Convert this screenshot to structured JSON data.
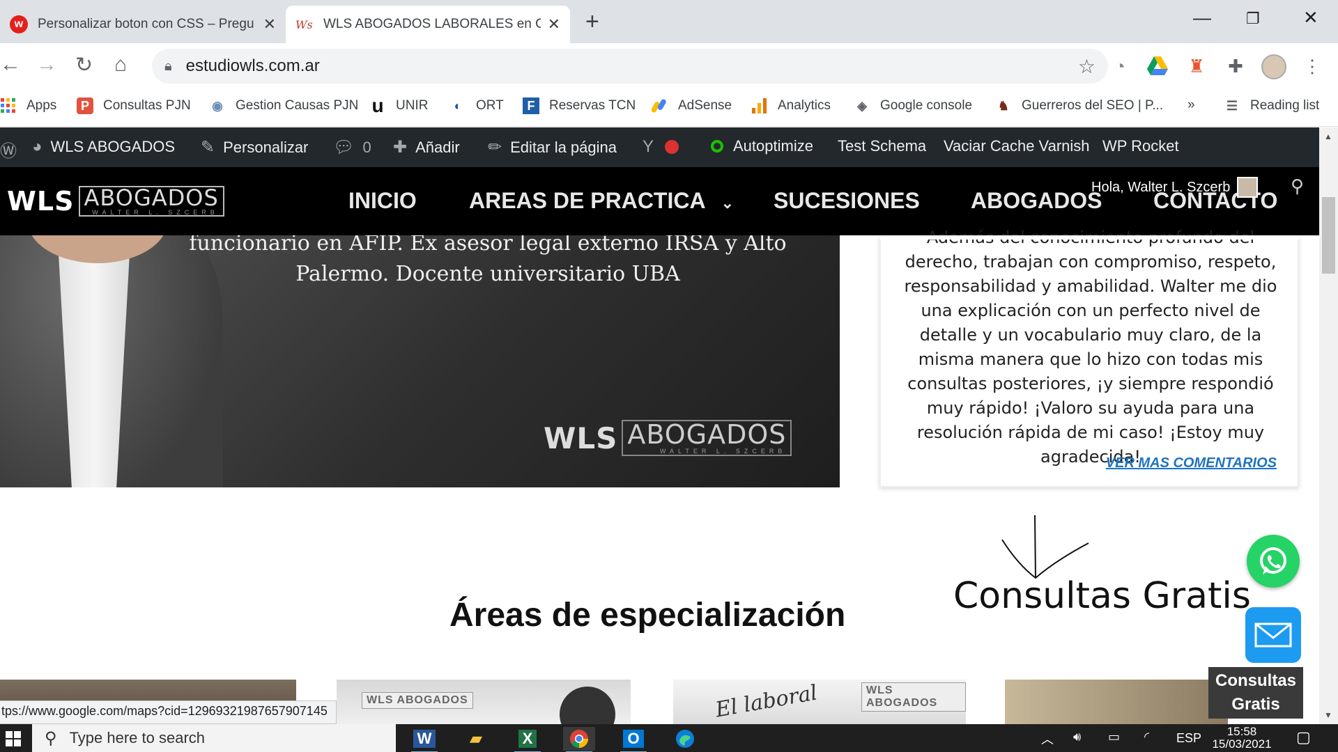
{
  "browser": {
    "tabs": [
      {
        "title": "Personalizar boton con CSS – Pregu",
        "active": false
      },
      {
        "title": "WLS ABOGADOS LABORALES en Ca",
        "active": true
      }
    ],
    "new_tab_symbol": "+",
    "url": "estudiowls.com.ar",
    "bookmarks": [
      {
        "label": "Apps",
        "icon": "apps-grid-icon"
      },
      {
        "label": "Consultas PJN",
        "icon": "pjn-icon"
      },
      {
        "label": "Gestion Causas PJN",
        "icon": "argentina-seal-icon"
      },
      {
        "label": "UNIR",
        "icon": "unir-icon"
      },
      {
        "label": "ORT",
        "icon": "ort-icon"
      },
      {
        "label": "Reservas TCN",
        "icon": "tcn-icon"
      },
      {
        "label": "AdSense",
        "icon": "adsense-icon"
      },
      {
        "label": "Analytics",
        "icon": "analytics-icon"
      },
      {
        "label": "Google console",
        "icon": "search-console-icon"
      },
      {
        "label": "Guerreros del SEO | P...",
        "icon": "seo-warrior-icon"
      }
    ],
    "bookmarks_overflow": "»",
    "reading_list": "Reading list"
  },
  "adminbar": {
    "site": "WLS ABOGADOS",
    "customize": "Personalizar",
    "comments_count": "0",
    "add": "Añadir",
    "edit_page": "Editar la página",
    "autoptimize": "Autoptimize",
    "test_schema": "Test Schema",
    "varnish": "Vaciar Cache Varnish",
    "wp_rocket": "WP Rocket"
  },
  "site": {
    "logo_wls": "WLS",
    "logo_abogados": "ABOGADOS",
    "logo_sub": "WALTER L. SZCERB",
    "menu": [
      "INICIO",
      "AREAS DE PRACTICA",
      "SUCESIONES",
      "ABOGADOS",
      "CONTACTO"
    ],
    "greeting": "Hola, Walter L. Szcerb"
  },
  "hero": {
    "line1": "funcionario en AFIP.  Ex asesor legal externo IRSA y Alto",
    "line2": "Palermo. Docente universitario UBA"
  },
  "testimonial": {
    "text": "Además del conocimiento profundo del derecho, trabajan con compromiso, respeto, responsabilidad y amabilidad. Walter me dio una explicación con un perfecto nivel de detalle y un vocabulario muy claro, de la misma manera que lo hizo con todas mis consultas posteriores, ¡y siempre respondió muy rápido! ¡Valoro su ayuda para una resolución rápida de mi caso! ¡Estoy muy agradecida!",
    "link": "VER MAS COMENTARIOS"
  },
  "consultas_title": "Consultas Gratis",
  "areas_title": "Áreas de especialización",
  "thumbs": [
    {
      "script": ""
    },
    {
      "logo": "WLS ABOGADOS"
    },
    {
      "logo": "WLS ABOGADOS",
      "script": "El laboral"
    },
    {
      "script": ""
    }
  ],
  "status_url": "tps://www.google.com/maps?cid=12969321987657907145",
  "widget": {
    "line1": "Consultas",
    "line2": "Gratis"
  },
  "taskbar": {
    "search_placeholder": "Type here to search",
    "lang": "ESP",
    "time": "15:58",
    "date": "15/03/2021"
  },
  "colors": {
    "adminbar": "#23282d",
    "header": "#000000",
    "link": "#1e73be",
    "whatsapp": "#25d366",
    "mail": "#1d9bf0"
  }
}
